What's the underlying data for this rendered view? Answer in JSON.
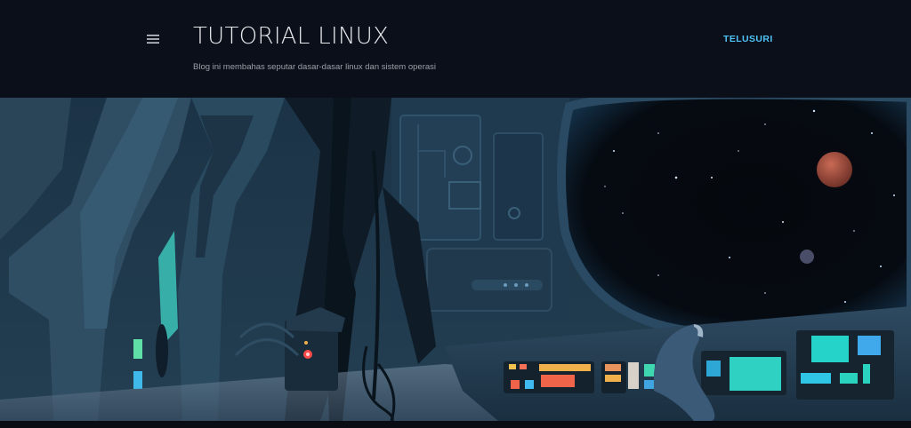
{
  "header": {
    "title": "TUTORIAL LINUX",
    "description": "Blog ini membahas seputar dasar-dasar linux dan sistem operasi",
    "search_label": "TELUSURI",
    "menu_icon": "hamburger-menu-icon"
  },
  "banner": {
    "image": "spaceship-cockpit-illustration"
  },
  "colors": {
    "background": "#0b0f19",
    "accent": "#4fc3f7",
    "title": "#e6e8ec",
    "subtitle": "#9aa0a8"
  }
}
